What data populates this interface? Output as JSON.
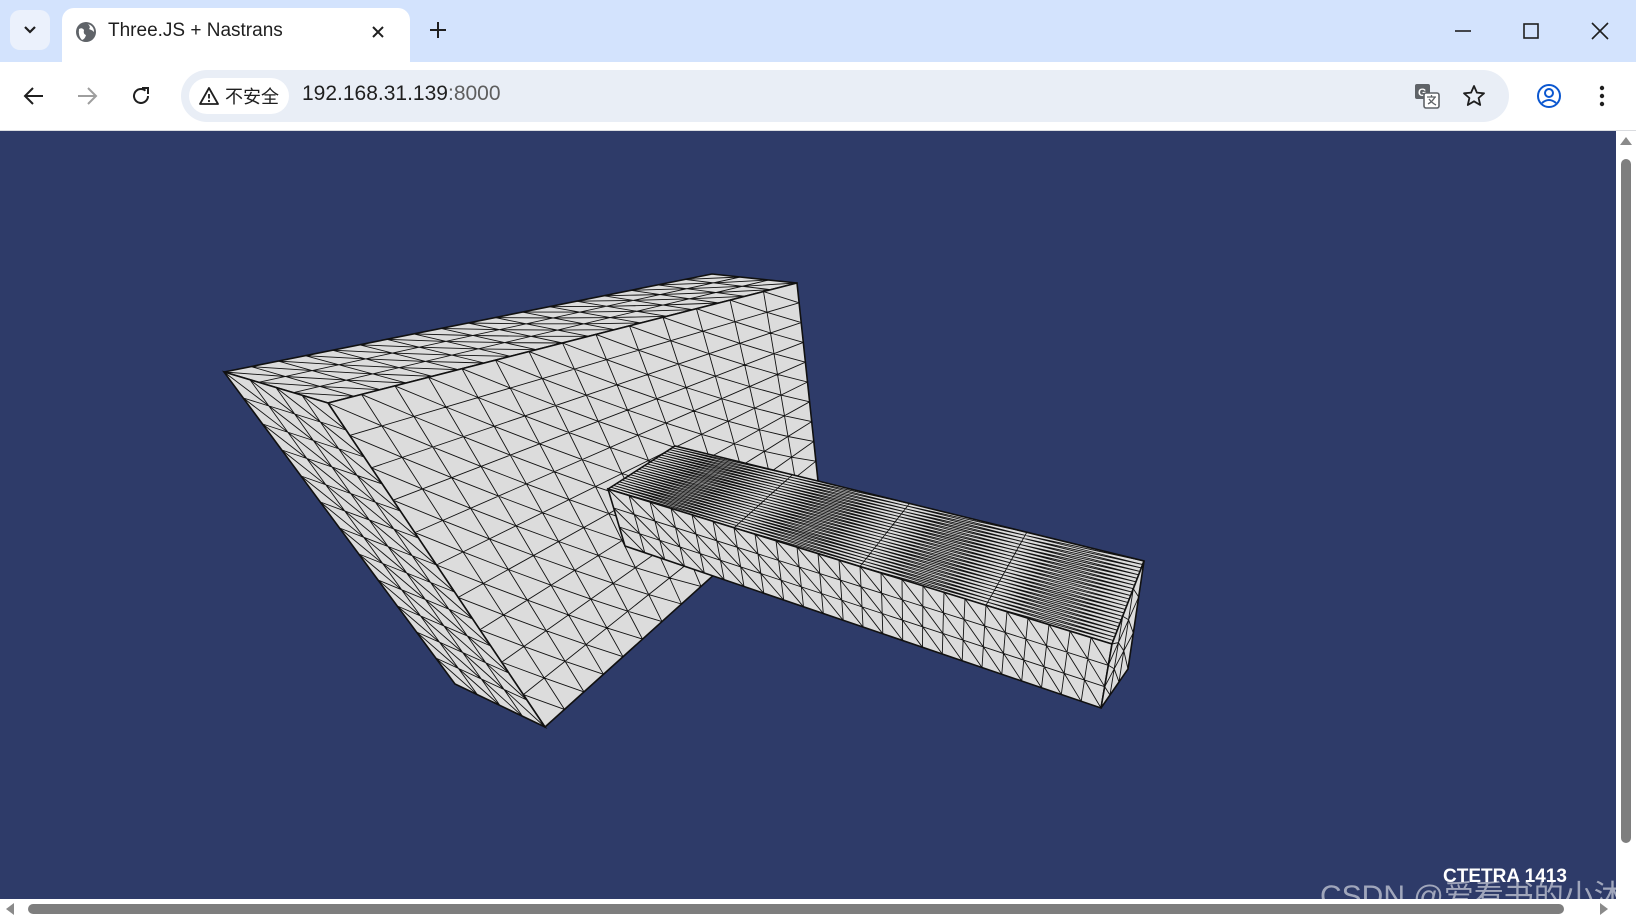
{
  "browser": {
    "tab": {
      "title": "Three.JS + Nastrans",
      "favicon": "globe-icon"
    },
    "security_chip": {
      "label": "不安全",
      "icon": "warning-icon"
    },
    "address": {
      "host": "192.168.31.139",
      "port": ":8000"
    },
    "icons": [
      "tab-search-icon",
      "close-icon",
      "plus-icon",
      "minimize-icon",
      "maximize-icon",
      "window-close-icon",
      "back-arrow-icon",
      "forward-arrow-icon",
      "reload-icon",
      "translate-icon",
      "star-icon",
      "profile-icon",
      "menu-dots-icon"
    ]
  },
  "viewport": {
    "background": "#2e3b69",
    "mesh_fill": "#dcdcdc",
    "mesh_stroke": "#111111",
    "element_info": "CTETRA 1413",
    "watermark": "CSDN @爱看书的小沐"
  }
}
